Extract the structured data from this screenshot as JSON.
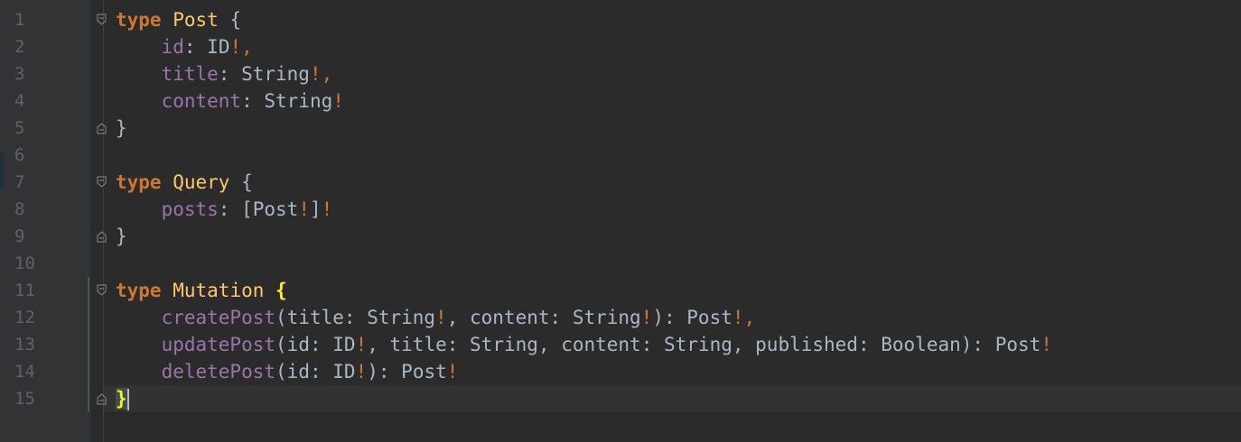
{
  "gutter": {
    "line_numbers": [
      "1",
      "2",
      "3",
      "4",
      "5",
      "6",
      "7",
      "8",
      "9",
      "10",
      "11",
      "12",
      "13",
      "14",
      "15"
    ]
  },
  "code": {
    "type_keyword": "type",
    "post": {
      "name": "Post",
      "open": "{",
      "close": "}",
      "fields": [
        {
          "name": "id",
          "colon": ": ",
          "type": "ID",
          "bang": "!",
          "comma": ","
        },
        {
          "name": "title",
          "colon": ": ",
          "type": "String",
          "bang": "!",
          "comma": ","
        },
        {
          "name": "content",
          "colon": ": ",
          "type": "String",
          "bang": "!",
          "comma": ""
        }
      ]
    },
    "query": {
      "name": "Query",
      "open": "{",
      "close": "}",
      "field": {
        "name": "posts",
        "colon": ": ",
        "lbr": "[",
        "type": "Post",
        "bang1": "!",
        "rbr": "]",
        "bang2": "!"
      }
    },
    "mutation": {
      "name": "Mutation",
      "open": "{",
      "close": "}",
      "create": {
        "name": "createPost",
        "p1": "(",
        "a1": "title",
        "c1": ": ",
        "t1": "String",
        "b1": "!",
        "s1": ", ",
        "a2": "content",
        "c2": ": ",
        "t2": "String",
        "b2": "!",
        "p2": ")",
        "c3": ": ",
        "ret": "Post",
        "b3": "!",
        "end": ","
      },
      "update": {
        "name": "updatePost",
        "p1": "(",
        "a1": "id",
        "c1": ": ",
        "t1": "ID",
        "b1": "!",
        "s1": ", ",
        "a2": "title",
        "c2": ": ",
        "t2": "String",
        "s2": ", ",
        "a3": "content",
        "c3": ": ",
        "t3": "String",
        "s3": ", ",
        "a4": "published",
        "c4": ": ",
        "t4": "Boolean",
        "p2": ")",
        "c5": ": ",
        "ret": "Post",
        "b2": "!"
      },
      "delete": {
        "name": "deletePost",
        "p1": "(",
        "a1": "id",
        "c1": ": ",
        "t1": "ID",
        "b1": "!",
        "p2": ")",
        "c2": ": ",
        "ret": "Post",
        "b2": "!"
      }
    }
  },
  "colors": {
    "background": "#2b2b2b",
    "keyword": "#cc7832",
    "type_name": "#ffc66d",
    "field": "#9876aa",
    "text": "#a9b7c6",
    "brace_match": "#ffef28"
  }
}
